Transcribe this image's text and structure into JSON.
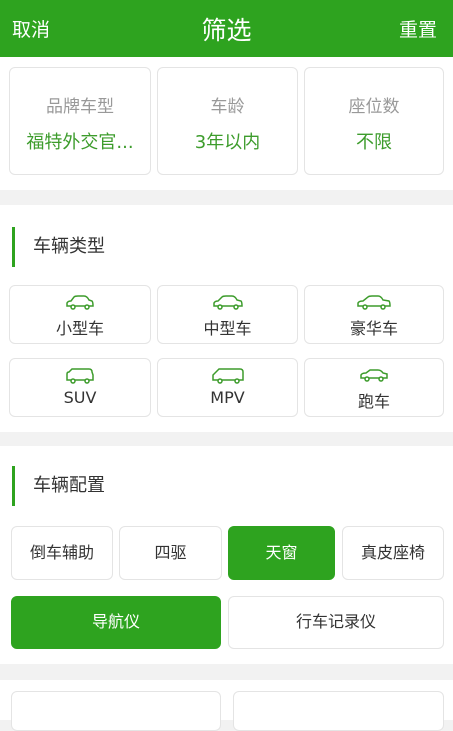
{
  "header": {
    "cancel_label": "取消",
    "title": "筛选",
    "reset_label": "重置"
  },
  "summary": [
    {
      "label": "品牌车型",
      "value": "福特外交官..."
    },
    {
      "label": "车龄",
      "value": "3年以内"
    },
    {
      "label": "座位数",
      "value": "不限"
    }
  ],
  "vehicle_type": {
    "title": "车辆类型",
    "items": [
      {
        "label": "小型车",
        "icon": "small-car-icon"
      },
      {
        "label": "中型车",
        "icon": "midsize-car-icon"
      },
      {
        "label": "豪华车",
        "icon": "luxury-car-icon"
      },
      {
        "label": "SUV",
        "icon": "suv-icon"
      },
      {
        "label": "MPV",
        "icon": "mpv-icon"
      },
      {
        "label": "跑车",
        "icon": "sports-car-icon"
      }
    ]
  },
  "config": {
    "title": "车辆配置",
    "options": [
      {
        "label": "倒车辅助",
        "selected": false
      },
      {
        "label": "四驱",
        "selected": false
      },
      {
        "label": "天窗",
        "selected": true
      },
      {
        "label": "真皮座椅",
        "selected": false
      },
      {
        "label": "导航仪",
        "selected": true
      },
      {
        "label": "行车记录仪",
        "selected": false
      }
    ]
  },
  "colors": {
    "accent": "#2ea31f",
    "value_text": "#3d9c2c",
    "border": "#e4e4e4"
  }
}
